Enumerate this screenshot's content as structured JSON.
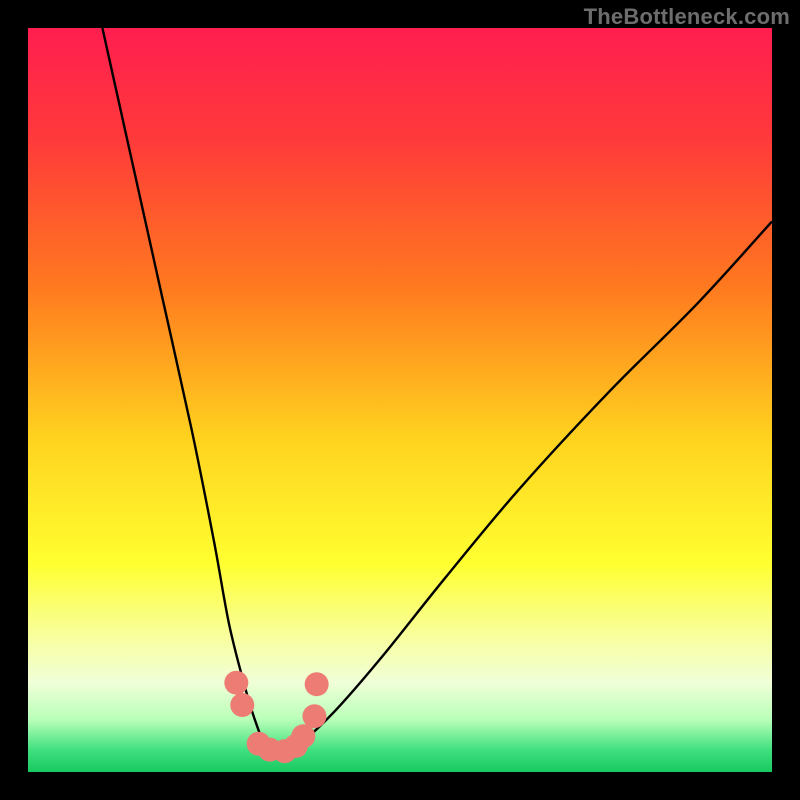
{
  "watermark": "TheBottleneck.com",
  "chart_data": {
    "type": "line",
    "title": "",
    "xlabel": "",
    "ylabel": "",
    "xlim": [
      0,
      100
    ],
    "ylim": [
      0,
      100
    ],
    "gradient_stops": [
      {
        "offset": 0,
        "color": "#ff1e50"
      },
      {
        "offset": 0.15,
        "color": "#ff3a3a"
      },
      {
        "offset": 0.35,
        "color": "#ff7a1f"
      },
      {
        "offset": 0.55,
        "color": "#ffd21f"
      },
      {
        "offset": 0.72,
        "color": "#ffff30"
      },
      {
        "offset": 0.82,
        "color": "#f8ffa0"
      },
      {
        "offset": 0.88,
        "color": "#f0ffd8"
      },
      {
        "offset": 0.93,
        "color": "#b8ffb8"
      },
      {
        "offset": 0.97,
        "color": "#40e080"
      },
      {
        "offset": 1.0,
        "color": "#18c860"
      }
    ],
    "series": [
      {
        "name": "bottleneck-curve",
        "x": [
          10,
          14,
          18,
          22,
          25,
          27,
          29,
          30.5,
          32,
          34,
          35.5,
          38,
          42,
          48,
          56,
          66,
          78,
          90,
          100
        ],
        "y": [
          100,
          82,
          64,
          46,
          31,
          20,
          12,
          7,
          3.5,
          2.5,
          3,
          5,
          9,
          16,
          26,
          38,
          51,
          63,
          74
        ]
      }
    ],
    "markers": [
      {
        "x": 28.0,
        "y": 12.0
      },
      {
        "x": 28.8,
        "y": 9.0
      },
      {
        "x": 31.0,
        "y": 3.8
      },
      {
        "x": 32.5,
        "y": 3.0
      },
      {
        "x": 34.5,
        "y": 2.8
      },
      {
        "x": 36.0,
        "y": 3.5
      },
      {
        "x": 37.0,
        "y": 4.8
      },
      {
        "x": 38.5,
        "y": 7.5
      },
      {
        "x": 38.8,
        "y": 11.8
      }
    ],
    "marker_color": "#ed7d74",
    "marker_radius": 12
  }
}
